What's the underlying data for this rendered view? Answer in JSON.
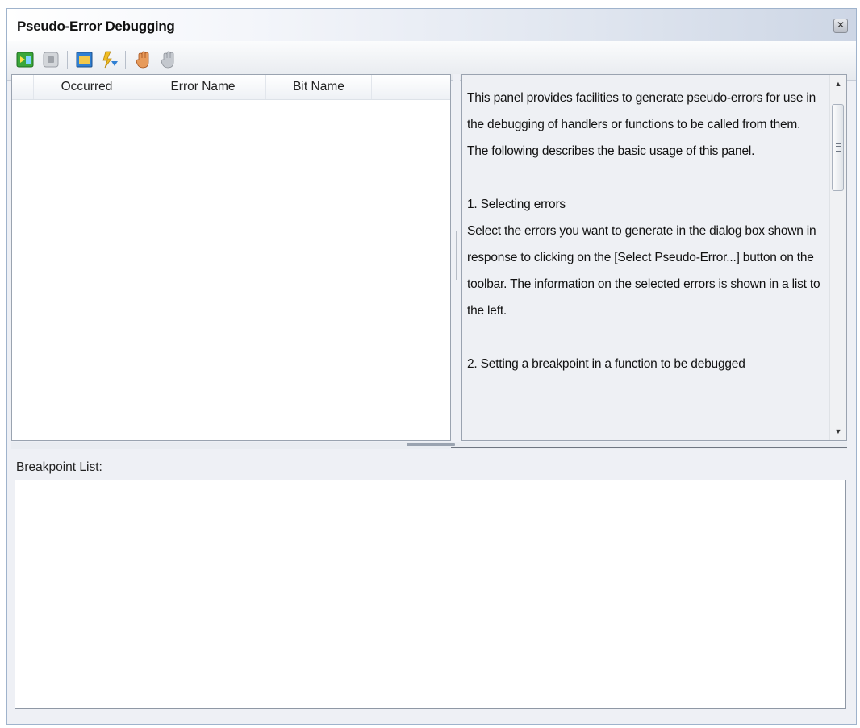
{
  "window": {
    "title": "Pseudo-Error Debugging",
    "close_glyph": "✕"
  },
  "toolbar": {
    "buttons": [
      {
        "name": "start-debugging-icon",
        "color": "#3aa63a"
      },
      {
        "name": "stop-icon",
        "color": "#8c8c8c"
      },
      {
        "name": "select-pseudo-error-icon",
        "color": "#2f7fd3"
      },
      {
        "name": "generate-error-icon",
        "color": "#e8b21c"
      },
      {
        "name": "hand-stop-icon",
        "color": "#d06a2a"
      },
      {
        "name": "hand-release-icon",
        "color": "#9aa0a8"
      }
    ]
  },
  "error_list": {
    "columns": [
      "Occurred",
      "Error Name",
      "Bit Name"
    ],
    "rows": []
  },
  "help": {
    "paragraphs": [
      "This panel provides facilities to generate pseudo-errors for use in the debugging of handlers or functions to be called from them.",
      "The following describes the basic usage of this panel.",
      "",
      "1. Selecting errors",
      "Select the errors you want to generate in the dialog box shown in response to clicking on the [Select Pseudo-Error...] button on the toolbar. The information on the selected errors is shown in a list to the left.",
      "",
      "2. Setting a breakpoint in a function to be debugged"
    ]
  },
  "breakpoints": {
    "label": "Breakpoint List:",
    "items": []
  }
}
